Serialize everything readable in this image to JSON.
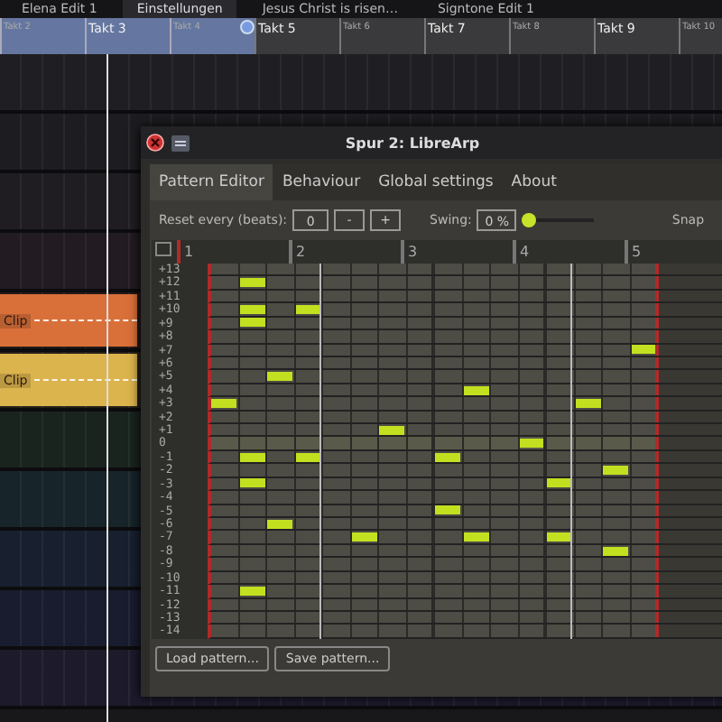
{
  "project_tabs": [
    {
      "label": "Elena Edit 1",
      "selected": false
    },
    {
      "label": "Einstellungen",
      "selected": true
    },
    {
      "label": "Jesus Christ is risen…",
      "selected": false
    },
    {
      "label": "Signtone Edit 1",
      "selected": false
    }
  ],
  "ruler": [
    {
      "label": "Takt 2",
      "in_loop": true,
      "major": false
    },
    {
      "label": "Takt 3",
      "in_loop": true,
      "major": true
    },
    {
      "label": "Takt 4",
      "in_loop": true,
      "major": false
    },
    {
      "label": "Takt 5",
      "in_loop": false,
      "major": true
    },
    {
      "label": "Takt 6",
      "in_loop": false,
      "major": false
    },
    {
      "label": "Takt 7",
      "in_loop": false,
      "major": true
    },
    {
      "label": "Takt 8",
      "in_loop": false,
      "major": false
    },
    {
      "label": "Takt 9",
      "in_loop": false,
      "major": true
    },
    {
      "label": "Takt 10",
      "in_loop": false,
      "major": false
    }
  ],
  "lanes": [
    {
      "kind": "empty",
      "color": "#1f1f23"
    },
    {
      "kind": "empty",
      "color": "#1d1d21"
    },
    {
      "kind": "empty",
      "color": "#201d22"
    },
    {
      "kind": "empty",
      "color": "#221b21"
    },
    {
      "kind": "clip",
      "color": "#241a18",
      "clip": {
        "label": "Clip",
        "color": "#d9703a"
      }
    },
    {
      "kind": "clip",
      "color": "#26221a",
      "clip": {
        "label": "Clip",
        "color": "#dcb44e"
      }
    },
    {
      "kind": "empty",
      "color": "#19241f"
    },
    {
      "kind": "empty",
      "color": "#172429"
    },
    {
      "kind": "empty",
      "color": "#18202f"
    },
    {
      "kind": "empty",
      "color": "#181c2e"
    },
    {
      "kind": "empty",
      "color": "#1d1a2c"
    }
  ],
  "plugin": {
    "title": "Spur 2: LibreArp",
    "tabs": [
      {
        "label": "Pattern Editor",
        "selected": true
      },
      {
        "label": "Behaviour",
        "selected": false
      },
      {
        "label": "Global settings",
        "selected": false
      },
      {
        "label": "About",
        "selected": false
      }
    ],
    "reset_label": "Reset every (beats):",
    "reset_value": "0",
    "decrement": "-",
    "increment": "+",
    "swing_label": "Swing:",
    "swing_value": "0 %",
    "swing": {
      "level": 0
    },
    "snap_label": "Snap",
    "beats": [
      "1",
      "2",
      "3",
      "4",
      "5"
    ],
    "rows": [
      {
        "label": "+13",
        "steps": [
          false,
          false,
          false,
          false,
          false,
          false,
          false,
          false,
          false,
          false,
          false,
          false,
          false,
          false,
          false,
          false
        ]
      },
      {
        "label": "+12",
        "steps": [
          false,
          true,
          false,
          false,
          false,
          false,
          false,
          false,
          false,
          false,
          false,
          false,
          false,
          false,
          false,
          false
        ]
      },
      {
        "label": "+11",
        "steps": [
          false,
          false,
          false,
          false,
          false,
          false,
          false,
          false,
          false,
          false,
          false,
          false,
          false,
          false,
          false,
          false
        ]
      },
      {
        "label": "+10",
        "steps": [
          false,
          true,
          false,
          true,
          false,
          false,
          false,
          false,
          false,
          false,
          false,
          false,
          false,
          false,
          false,
          false
        ]
      },
      {
        "label": "+9",
        "steps": [
          false,
          true,
          false,
          false,
          false,
          false,
          false,
          false,
          false,
          false,
          false,
          false,
          false,
          false,
          false,
          false
        ]
      },
      {
        "label": "+8",
        "steps": [
          false,
          false,
          false,
          false,
          false,
          false,
          false,
          false,
          false,
          false,
          false,
          false,
          false,
          false,
          false,
          false
        ]
      },
      {
        "label": "+7",
        "steps": [
          false,
          false,
          false,
          false,
          false,
          false,
          false,
          false,
          false,
          false,
          false,
          false,
          false,
          false,
          false,
          true
        ]
      },
      {
        "label": "+6",
        "steps": [
          false,
          false,
          false,
          false,
          false,
          false,
          false,
          false,
          false,
          false,
          false,
          false,
          false,
          false,
          false,
          false
        ]
      },
      {
        "label": "+5",
        "steps": [
          false,
          false,
          true,
          false,
          false,
          false,
          false,
          false,
          false,
          false,
          false,
          false,
          false,
          false,
          false,
          false
        ]
      },
      {
        "label": "+4",
        "steps": [
          false,
          false,
          false,
          false,
          false,
          false,
          false,
          false,
          false,
          true,
          false,
          false,
          false,
          false,
          false,
          false
        ]
      },
      {
        "label": "+3",
        "steps": [
          true,
          false,
          false,
          false,
          false,
          false,
          false,
          false,
          false,
          false,
          false,
          false,
          false,
          true,
          false,
          false
        ]
      },
      {
        "label": "+2",
        "steps": [
          false,
          false,
          false,
          false,
          false,
          false,
          false,
          false,
          false,
          false,
          false,
          false,
          false,
          false,
          false,
          false
        ]
      },
      {
        "label": "+1",
        "steps": [
          false,
          false,
          false,
          false,
          false,
          false,
          true,
          false,
          false,
          false,
          false,
          false,
          false,
          false,
          false,
          false
        ]
      },
      {
        "label": "0",
        "steps": [
          false,
          false,
          false,
          false,
          false,
          false,
          false,
          false,
          false,
          false,
          false,
          true,
          false,
          false,
          false,
          false
        ]
      },
      {
        "label": "-1",
        "steps": [
          false,
          true,
          false,
          true,
          false,
          false,
          false,
          false,
          true,
          false,
          false,
          false,
          false,
          false,
          false,
          false
        ]
      },
      {
        "label": "-2",
        "steps": [
          false,
          false,
          false,
          false,
          false,
          false,
          false,
          false,
          false,
          false,
          false,
          false,
          false,
          false,
          true,
          false
        ]
      },
      {
        "label": "-3",
        "steps": [
          false,
          true,
          false,
          false,
          false,
          false,
          false,
          false,
          false,
          false,
          false,
          false,
          true,
          false,
          false,
          false
        ]
      },
      {
        "label": "-4",
        "steps": [
          false,
          false,
          false,
          false,
          false,
          false,
          false,
          false,
          false,
          false,
          false,
          false,
          false,
          false,
          false,
          false
        ]
      },
      {
        "label": "-5",
        "steps": [
          false,
          false,
          false,
          false,
          false,
          false,
          false,
          false,
          true,
          false,
          false,
          false,
          false,
          false,
          false,
          false
        ]
      },
      {
        "label": "-6",
        "steps": [
          false,
          false,
          true,
          false,
          false,
          false,
          false,
          false,
          false,
          false,
          false,
          false,
          false,
          false,
          false,
          false
        ]
      },
      {
        "label": "-7",
        "steps": [
          false,
          false,
          false,
          false,
          false,
          true,
          false,
          false,
          false,
          true,
          false,
          false,
          true,
          false,
          false,
          false
        ]
      },
      {
        "label": "-8",
        "steps": [
          false,
          false,
          false,
          false,
          false,
          false,
          false,
          false,
          false,
          false,
          false,
          false,
          false,
          false,
          true,
          false
        ]
      },
      {
        "label": "-9",
        "steps": [
          false,
          false,
          false,
          false,
          false,
          false,
          false,
          false,
          false,
          false,
          false,
          false,
          false,
          false,
          false,
          false
        ]
      },
      {
        "label": "-10",
        "steps": [
          false,
          false,
          false,
          false,
          false,
          false,
          false,
          false,
          false,
          false,
          false,
          false,
          false,
          false,
          false,
          false
        ]
      },
      {
        "label": "-11",
        "steps": [
          false,
          true,
          false,
          false,
          false,
          false,
          false,
          false,
          false,
          false,
          false,
          false,
          false,
          false,
          false,
          false
        ]
      },
      {
        "label": "-12",
        "steps": [
          false,
          false,
          false,
          false,
          false,
          false,
          false,
          false,
          false,
          false,
          false,
          false,
          false,
          false,
          false,
          false
        ]
      },
      {
        "label": "-13",
        "steps": [
          false,
          false,
          false,
          false,
          false,
          false,
          false,
          false,
          false,
          false,
          false,
          false,
          false,
          false,
          false,
          false
        ]
      },
      {
        "label": "-14",
        "steps": [
          false,
          false,
          false,
          false,
          false,
          false,
          false,
          false,
          false,
          false,
          false,
          false,
          false,
          false,
          false,
          false
        ]
      }
    ],
    "buttons": [
      "Load pattern...",
      "Save pattern..."
    ]
  }
}
